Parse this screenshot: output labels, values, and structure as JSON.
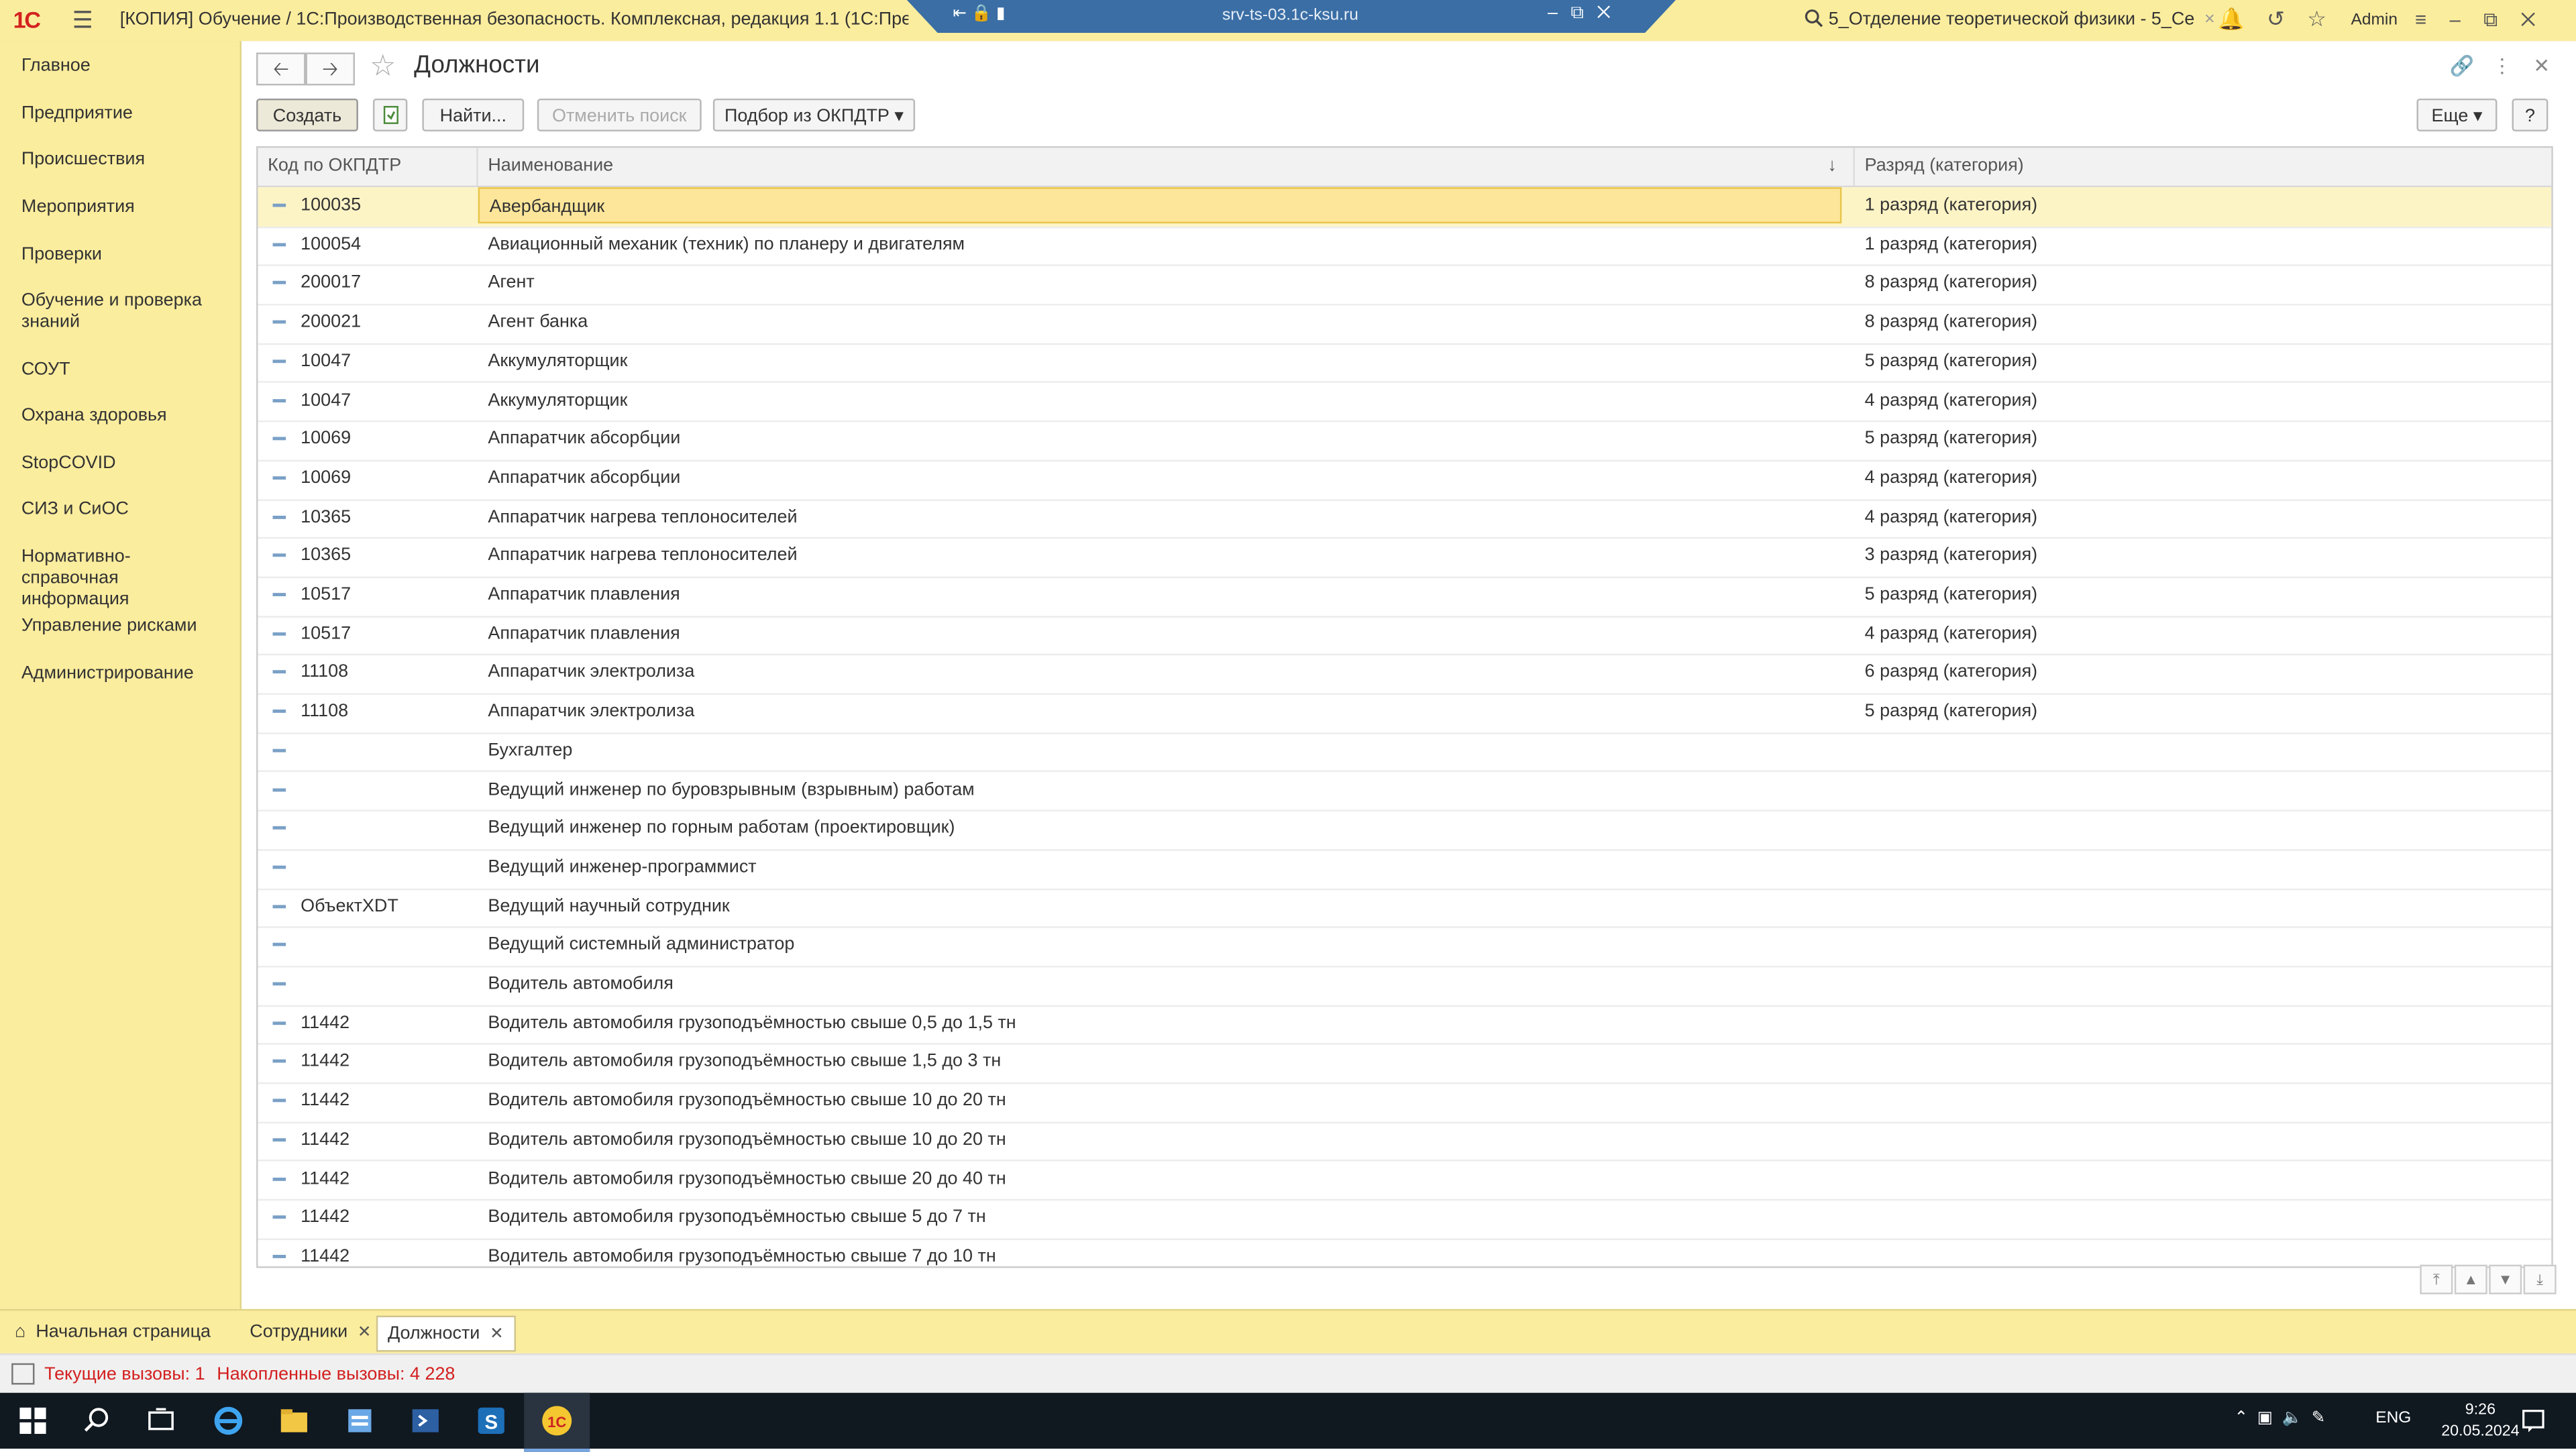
{
  "titlebar": {
    "logo": "1С",
    "title": "[КОПИЯ] Обучение / 1С:Производственная безопасность. Комплексная, редакция 1.1  (1С:Предприятие)",
    "rdp_host": "srv-ts-03.1c-ksu.ru",
    "search_text": "5_Отделение теоретической физики - 5_Се",
    "user": "Admin"
  },
  "sidebar": {
    "items": [
      {
        "label": "Главное"
      },
      {
        "label": "Предприятие"
      },
      {
        "label": "Происшествия"
      },
      {
        "label": "Мероприятия"
      },
      {
        "label": "Проверки"
      },
      {
        "label": "Обучение и проверка знаний"
      },
      {
        "label": "СОУТ"
      },
      {
        "label": "Охрана здоровья"
      },
      {
        "label": "StopCOVID"
      },
      {
        "label": "СИЗ и СиОС"
      },
      {
        "label": "Нормативно-справочная информация"
      },
      {
        "label": "Управление рисками"
      },
      {
        "label": "Администрирование"
      }
    ]
  },
  "form": {
    "title": "Должности",
    "toolbar": {
      "create": "Создать",
      "find": "Найти...",
      "cancel_search": "Отменить поиск",
      "select_okpdtr": "Подбор из ОКПДТР",
      "more": "Еще",
      "help": "?"
    },
    "columns": {
      "code": "Код по ОКПДТР",
      "name": "Наименование",
      "rank": "Разряд (категория)"
    },
    "rows": [
      {
        "code": "100035",
        "name": "Авербандщик",
        "rank": "1 разряд (категория)"
      },
      {
        "code": "100054",
        "name": "Авиационный механик (техник) по планеру и двигателям",
        "rank": "1 разряд (категория)"
      },
      {
        "code": "200017",
        "name": "Агент",
        "rank": "8 разряд (категория)"
      },
      {
        "code": "200021",
        "name": "Агент банка",
        "rank": "8 разряд (категория)"
      },
      {
        "code": "10047",
        "name": "Аккумуляторщик",
        "rank": "5 разряд (категория)"
      },
      {
        "code": "10047",
        "name": "Аккумуляторщик",
        "rank": "4 разряд (категория)"
      },
      {
        "code": "10069",
        "name": "Аппаратчик абсорбции",
        "rank": "5 разряд (категория)"
      },
      {
        "code": "10069",
        "name": "Аппаратчик абсорбции",
        "rank": "4 разряд (категория)"
      },
      {
        "code": "10365",
        "name": "Аппаратчик нагрева теплоносителей",
        "rank": "4 разряд (категория)"
      },
      {
        "code": "10365",
        "name": "Аппаратчик нагрева теплоносителей",
        "rank": "3 разряд (категория)"
      },
      {
        "code": "10517",
        "name": "Аппаратчик плавления",
        "rank": "5 разряд (категория)"
      },
      {
        "code": "10517",
        "name": "Аппаратчик плавления",
        "rank": "4 разряд (категория)"
      },
      {
        "code": "11108",
        "name": "Аппаратчик электролиза",
        "rank": "6 разряд (категория)"
      },
      {
        "code": "11108",
        "name": "Аппаратчик электролиза",
        "rank": "5 разряд (категория)"
      },
      {
        "code": "",
        "name": "Бухгалтер",
        "rank": ""
      },
      {
        "code": "",
        "name": "Ведущий инженер по буровзрывным (взрывным) работам",
        "rank": ""
      },
      {
        "code": "",
        "name": "Ведущий инженер по горным работам (проектировщик)",
        "rank": ""
      },
      {
        "code": "",
        "name": "Ведущий инженер-программист",
        "rank": ""
      },
      {
        "code": "ОбъектXDT",
        "name": "Ведущий научный сотрудник",
        "rank": ""
      },
      {
        "code": "",
        "name": "Ведущий системный администратор",
        "rank": ""
      },
      {
        "code": "",
        "name": "Водитель автомобиля",
        "rank": ""
      },
      {
        "code": "11442",
        "name": "Водитель автомобиля грузоподъёмностью свыше 0,5 до 1,5 тн",
        "rank": ""
      },
      {
        "code": "11442",
        "name": "Водитель автомобиля грузоподъёмностью свыше 1,5 до 3 тн",
        "rank": ""
      },
      {
        "code": "11442",
        "name": "Водитель автомобиля грузоподъёмностью свыше 10 до 20 тн",
        "rank": ""
      },
      {
        "code": "11442",
        "name": "Водитель автомобиля грузоподъёмностью свыше 10 до 20 тн",
        "rank": ""
      },
      {
        "code": "11442",
        "name": "Водитель автомобиля грузоподъёмностью свыше 20 до 40 тн",
        "rank": ""
      },
      {
        "code": "11442",
        "name": "Водитель автомобиля грузоподъёмностью свыше 5 до 7 тн",
        "rank": ""
      },
      {
        "code": "11442",
        "name": "Водитель автомобиля грузоподъёмностью свыше 7 до 10 тн",
        "rank": ""
      }
    ]
  },
  "tabs": {
    "home": "Начальная страница",
    "employees": "Сотрудники",
    "positions": "Должности"
  },
  "status": {
    "current_calls": "Текущие вызовы: 1",
    "accumulated_calls": "Накопленные вызовы: 4 228"
  },
  "taskbar": {
    "lang": "ENG",
    "time": "9:26",
    "date": "20.05.2024"
  },
  "colors": {
    "accent_yellow": "#fbed9e",
    "selected_row": "#fde69a",
    "status_red": "#d32020",
    "taskbar": "#101820"
  }
}
